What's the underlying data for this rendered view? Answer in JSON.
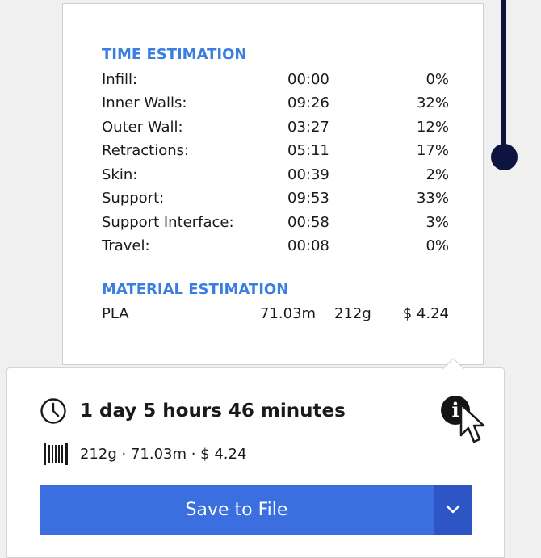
{
  "time_estimation": {
    "title": "TIME ESTIMATION",
    "rows": [
      {
        "label": "Infill:",
        "time": "00:00",
        "percent": "0%"
      },
      {
        "label": "Inner Walls:",
        "time": "09:26",
        "percent": "32%"
      },
      {
        "label": "Outer Wall:",
        "time": "03:27",
        "percent": "12%"
      },
      {
        "label": "Retractions:",
        "time": "05:11",
        "percent": "17%"
      },
      {
        "label": "Skin:",
        "time": "00:39",
        "percent": "2%"
      },
      {
        "label": "Support:",
        "time": "09:53",
        "percent": "33%"
      },
      {
        "label": "Support Interface:",
        "time": "00:58",
        "percent": "3%"
      },
      {
        "label": "Travel:",
        "time": "00:08",
        "percent": "0%"
      }
    ]
  },
  "material_estimation": {
    "title": "MATERIAL ESTIMATION",
    "rows": [
      {
        "material": "PLA",
        "length": "71.03m",
        "weight": "212g",
        "cost": "$ 4.24"
      }
    ]
  },
  "summary": {
    "print_time": "1 day 5 hours 46 minutes",
    "material": "212g · 71.03m · $ 4.24"
  },
  "actions": {
    "save_label": "Save to File"
  },
  "icons": {
    "clock": "clock-icon",
    "spool": "spool-icon",
    "info": "info-icon",
    "cursor": "cursor-icon",
    "dropdown": "chevron-down-icon"
  },
  "colors": {
    "accent": "#3b6fe0",
    "section_title": "#3a7fe0",
    "slider": "#0d1440"
  }
}
